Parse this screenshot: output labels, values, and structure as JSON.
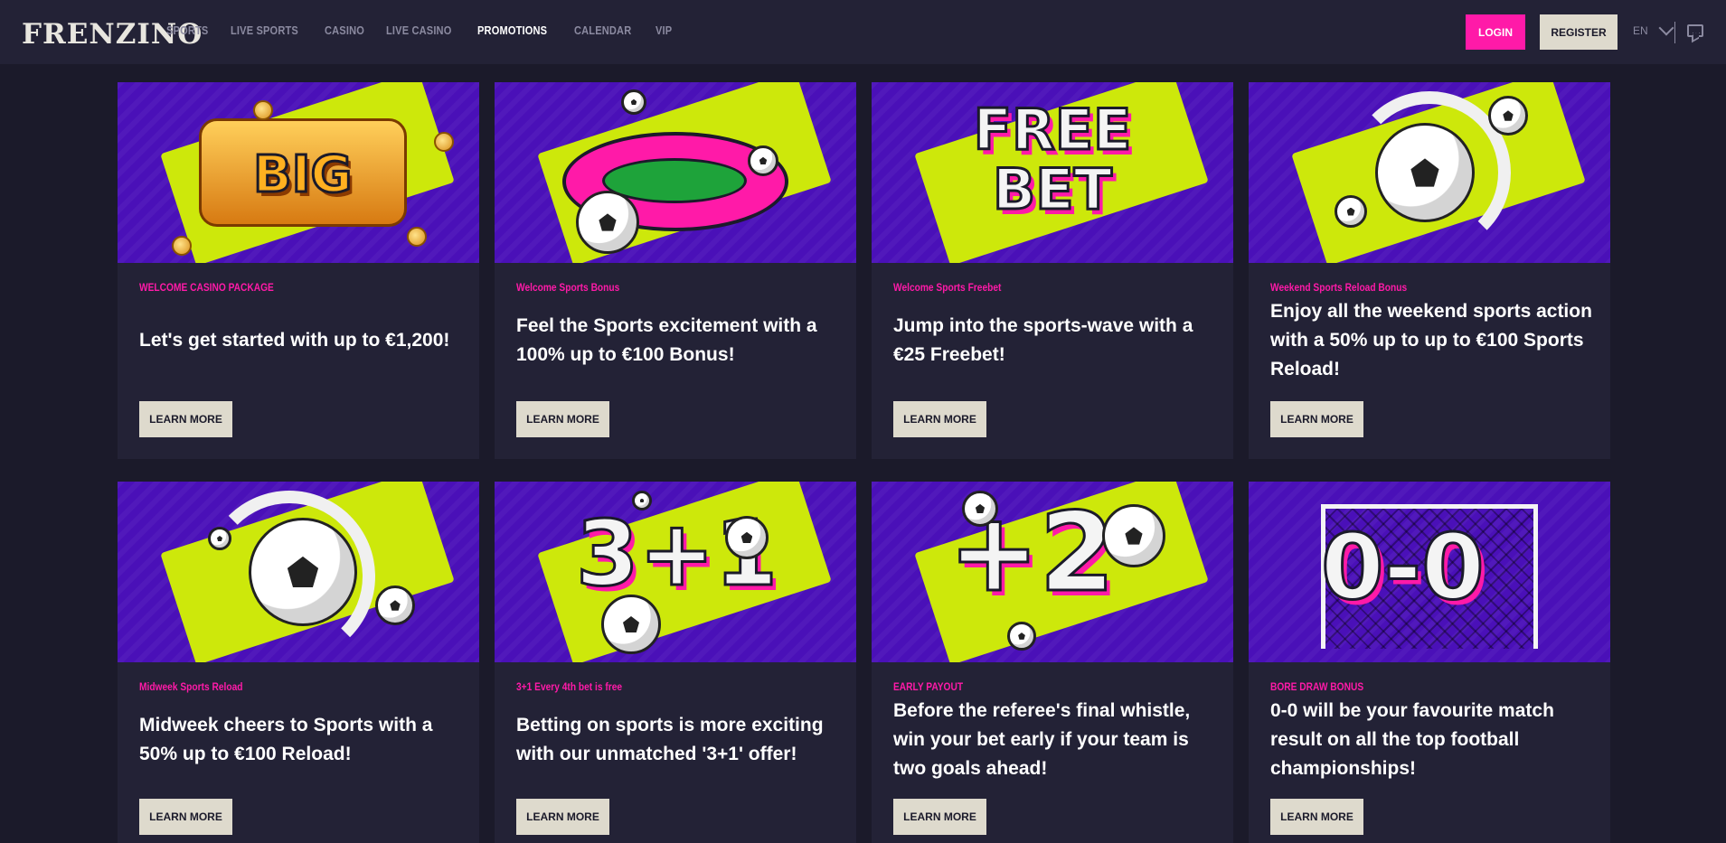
{
  "brand": {
    "name": "FRENZINO"
  },
  "nav": [
    {
      "label": "SPORTS"
    },
    {
      "label": "LIVE SPORTS"
    },
    {
      "label": "CASINO"
    },
    {
      "label": "LIVE CASINO"
    },
    {
      "label": "PROMOTIONS",
      "active": true
    },
    {
      "label": "CALENDAR"
    },
    {
      "label": "VIP"
    }
  ],
  "header": {
    "login_label": "LOGIN",
    "register_label": "REGISTER",
    "language": "EN"
  },
  "colors": {
    "accent": "#ff1aa8",
    "background": "#1b1a2a",
    "card": "#232236",
    "promo_bg": "#4a10b8",
    "splash": "#cde80b",
    "button": "#dedacd"
  },
  "promotions": [
    {
      "category": "WELCOME CASINO PACKAGE",
      "headline": "Let's get started with up to €1,200!",
      "button": "LEARN MORE",
      "image_text": "BIG",
      "image_icon": "slot-machine-icon"
    },
    {
      "category": "Welcome Sports Bonus",
      "headline": "Feel the Sports excitement with a 100% up to €100 Bonus!",
      "button": "LEARN MORE",
      "image_icon": "stadium-icon"
    },
    {
      "category": "Welcome Sports Freebet",
      "headline": "Jump into the sports-wave with a €25 Freebet!",
      "button": "LEARN MORE",
      "image_text": "FREE BET",
      "image_icon": "free-bet-icon"
    },
    {
      "category": "Weekend Sports Reload Bonus",
      "headline": "Enjoy all the weekend sports action with a 50% up to up to €100 Sports Reload!",
      "button": "LEARN MORE",
      "image_icon": "reload-football-icon"
    },
    {
      "category": "Midweek Sports Reload",
      "headline": "Midweek cheers to Sports with a 50% up to €100 Reload!",
      "button": "LEARN MORE",
      "image_icon": "reload-football-icon"
    },
    {
      "category": "3+1 Every 4th bet is free",
      "headline": "Betting on sports is more exciting with our unmatched '3+1' offer!",
      "button": "LEARN MORE",
      "image_text": "3+1",
      "image_icon": "three-plus-one-icon"
    },
    {
      "category": "EARLY PAYOUT",
      "headline": "Before the referee's final whistle, win your bet early if your team is two goals ahead!",
      "button": "LEARN MORE",
      "image_text": "+2",
      "image_icon": "plus-two-icon"
    },
    {
      "category": "BORE DRAW BONUS",
      "headline": "0-0 will be your favourite match result on all the top football championships!",
      "button": "LEARN MORE",
      "image_text": "0-0",
      "image_icon": "goal-net-icon"
    }
  ]
}
